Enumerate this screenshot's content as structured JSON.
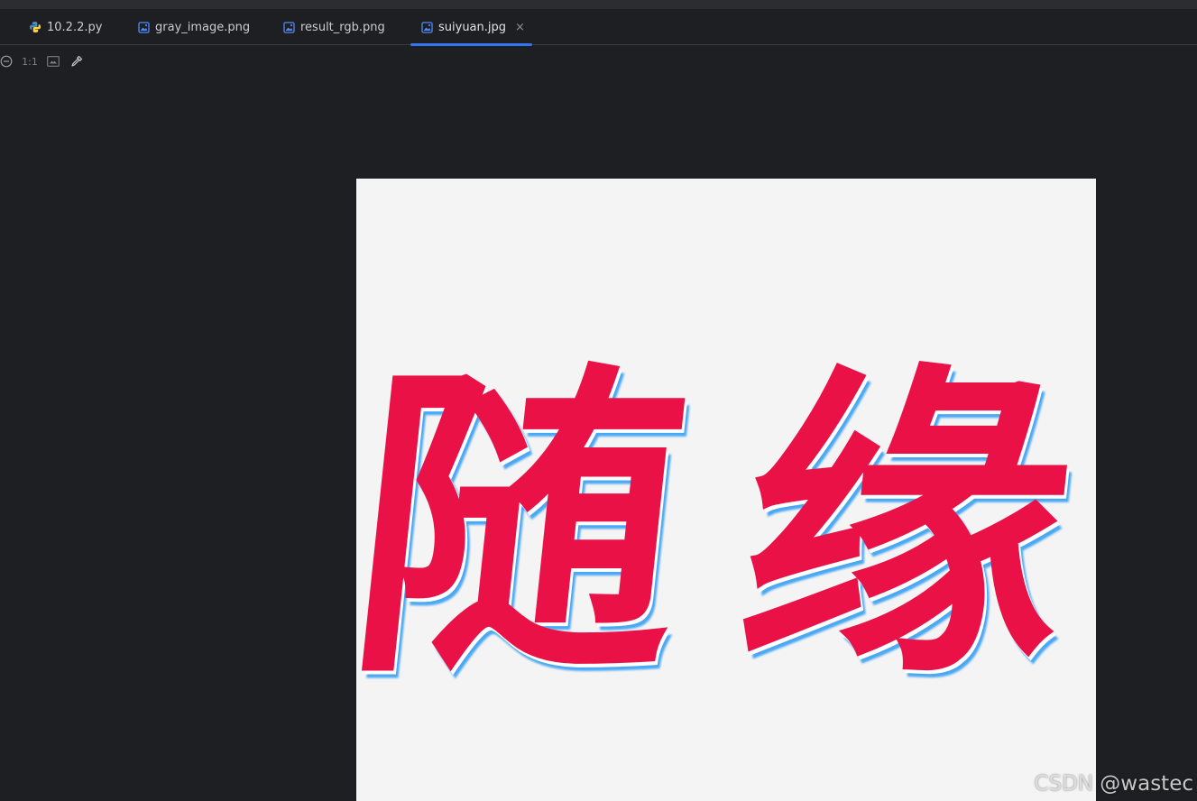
{
  "tabs": [
    {
      "label": "10.2.2.py",
      "icon": "python-file-icon",
      "active": false
    },
    {
      "label": "gray_image.png",
      "icon": "image-file-icon",
      "active": false
    },
    {
      "label": "result_rgb.png",
      "icon": "image-file-icon",
      "active": false
    },
    {
      "label": "suiyuan.jpg",
      "icon": "image-file-icon",
      "active": true,
      "close": "×"
    }
  ],
  "toolbar": {
    "zoom_out_icon": "zoom-out-icon",
    "actual_size_label": "1:1",
    "fit_icon": "fit-to-window-icon",
    "color_picker_icon": "eyedropper-icon"
  },
  "image": {
    "text_char_1": "随",
    "text_char_2": "缘",
    "text_color": "#ea1147",
    "background": "#f4f4f5"
  },
  "watermark": "CSDN @wastec",
  "colors": {
    "accent": "#3574f0",
    "editor_bg": "#1e1f22"
  }
}
